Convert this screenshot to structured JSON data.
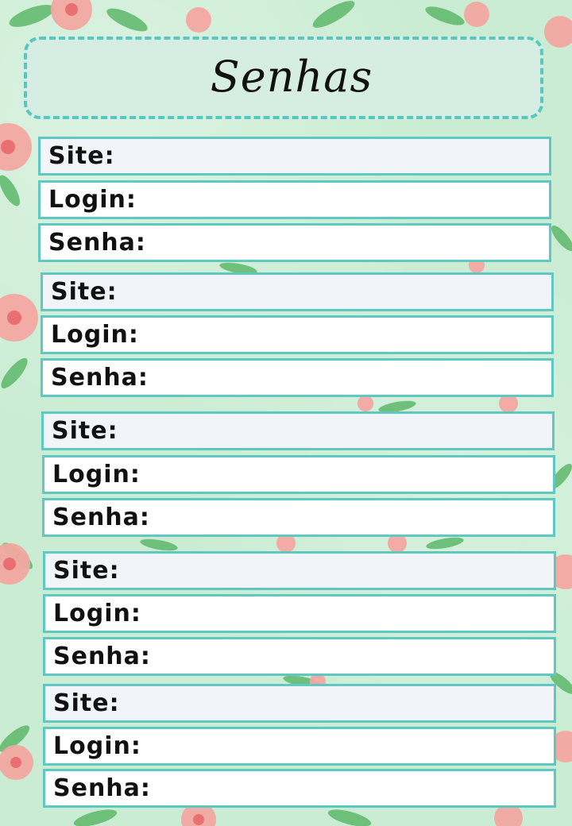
{
  "page": {
    "title": "Senhas"
  },
  "colors": {
    "accent": "#5fc8c2",
    "background": "#c9ecd2",
    "title_box": "#d5ede3",
    "site_row": "#f1f4f8",
    "row": "#ffffff",
    "flower": "#f2a3a0",
    "leaf": "#4fae5b"
  },
  "entries": [
    {
      "site_label": "Site:",
      "login_label": "Login:",
      "password_label": "Senha:"
    },
    {
      "site_label": "Site:",
      "login_label": "Login:",
      "password_label": "Senha:"
    },
    {
      "site_label": "Site:",
      "login_label": "Login:",
      "password_label": "Senha:"
    },
    {
      "site_label": "Site:",
      "login_label": "Login:",
      "password_label": "Senha:"
    },
    {
      "site_label": "Site:",
      "login_label": "Login:",
      "password_label": "Senha:"
    }
  ]
}
